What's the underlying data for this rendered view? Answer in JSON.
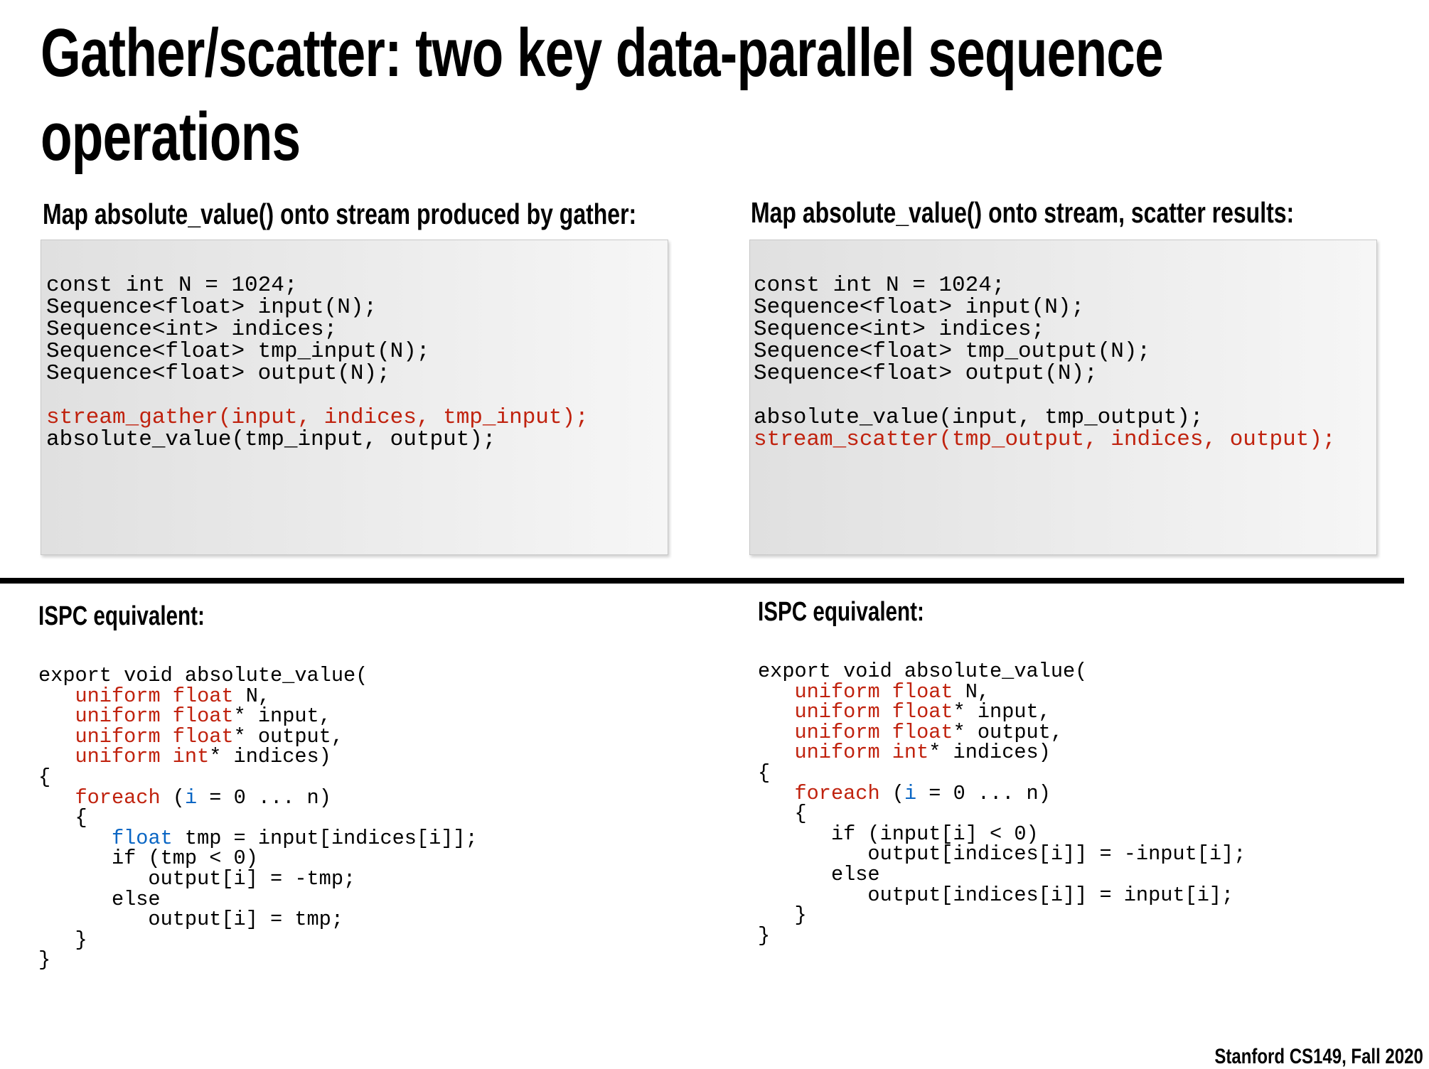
{
  "title": {
    "line1": "Gather/scatter: two key data-parallel sequence",
    "line2": "operations"
  },
  "left": {
    "heading": "Map absolute_value() onto stream produced by gather:",
    "code": [
      [
        {
          "t": "const int N = 1024;",
          "c": "k"
        }
      ],
      [
        {
          "t": "Sequence<float> input(N);",
          "c": "k"
        }
      ],
      [
        {
          "t": "Sequence<int> indices;",
          "c": "k"
        }
      ],
      [
        {
          "t": "Sequence<float> tmp_input(N);",
          "c": "k"
        }
      ],
      [
        {
          "t": "Sequence<float> output(N);",
          "c": "k"
        }
      ],
      [
        {
          "t": "",
          "c": "k"
        }
      ],
      [
        {
          "t": "stream_gather(input, indices, tmp_input);",
          "c": "r"
        }
      ],
      [
        {
          "t": "absolute_value(tmp_input, output);",
          "c": "k"
        }
      ]
    ],
    "ispc_heading": "ISPC equivalent:",
    "ispc": [
      [
        {
          "t": "export void absolute_value(",
          "c": "k"
        }
      ],
      [
        {
          "t": "   ",
          "c": "k"
        },
        {
          "t": "uniform float",
          "c": "r"
        },
        {
          "t": " N,",
          "c": "k"
        }
      ],
      [
        {
          "t": "   ",
          "c": "k"
        },
        {
          "t": "uniform float",
          "c": "r"
        },
        {
          "t": "* input,",
          "c": "k"
        }
      ],
      [
        {
          "t": "   ",
          "c": "k"
        },
        {
          "t": "uniform float",
          "c": "r"
        },
        {
          "t": "* output,",
          "c": "k"
        }
      ],
      [
        {
          "t": "   ",
          "c": "k"
        },
        {
          "t": "uniform int",
          "c": "r"
        },
        {
          "t": "* indices)",
          "c": "k"
        }
      ],
      [
        {
          "t": "{",
          "c": "k"
        }
      ],
      [
        {
          "t": "   ",
          "c": "k"
        },
        {
          "t": "foreach",
          "c": "r"
        },
        {
          "t": " (",
          "c": "k"
        },
        {
          "t": "i",
          "c": "b"
        },
        {
          "t": " = 0 ... n)",
          "c": "k"
        }
      ],
      [
        {
          "t": "   {",
          "c": "k"
        }
      ],
      [
        {
          "t": "      ",
          "c": "k"
        },
        {
          "t": "float",
          "c": "b"
        },
        {
          "t": " tmp = input[indices[i]];",
          "c": "k"
        }
      ],
      [
        {
          "t": "      if (tmp < 0)",
          "c": "k"
        }
      ],
      [
        {
          "t": "         output[i] = -tmp;",
          "c": "k"
        }
      ],
      [
        {
          "t": "      else",
          "c": "k"
        }
      ],
      [
        {
          "t": "         output[i] = tmp;",
          "c": "k"
        }
      ],
      [
        {
          "t": "   }",
          "c": "k"
        }
      ],
      [
        {
          "t": "}",
          "c": "k"
        }
      ]
    ]
  },
  "right": {
    "heading": "Map absolute_value() onto stream, scatter results:",
    "code": [
      [
        {
          "t": "const int N = 1024;",
          "c": "k"
        }
      ],
      [
        {
          "t": "Sequence<float> input(N);",
          "c": "k"
        }
      ],
      [
        {
          "t": "Sequence<int> indices;",
          "c": "k"
        }
      ],
      [
        {
          "t": "Sequence<float> tmp_output(N);",
          "c": "k"
        }
      ],
      [
        {
          "t": "Sequence<float> output(N);",
          "c": "k"
        }
      ],
      [
        {
          "t": "",
          "c": "k"
        }
      ],
      [
        {
          "t": "absolute_value(input, tmp_output);",
          "c": "k"
        }
      ],
      [
        {
          "t": "stream_scatter(tmp_output, indices, output);",
          "c": "r"
        }
      ]
    ],
    "ispc_heading": "ISPC equivalent:",
    "ispc": [
      [
        {
          "t": "export void absolute_value(",
          "c": "k"
        }
      ],
      [
        {
          "t": "   ",
          "c": "k"
        },
        {
          "t": "uniform float",
          "c": "r"
        },
        {
          "t": " N,",
          "c": "k"
        }
      ],
      [
        {
          "t": "   ",
          "c": "k"
        },
        {
          "t": "uniform float",
          "c": "r"
        },
        {
          "t": "* input,",
          "c": "k"
        }
      ],
      [
        {
          "t": "   ",
          "c": "k"
        },
        {
          "t": "uniform float",
          "c": "r"
        },
        {
          "t": "* output,",
          "c": "k"
        }
      ],
      [
        {
          "t": "   ",
          "c": "k"
        },
        {
          "t": "uniform int",
          "c": "r"
        },
        {
          "t": "* indices)",
          "c": "k"
        }
      ],
      [
        {
          "t": "{",
          "c": "k"
        }
      ],
      [
        {
          "t": "   ",
          "c": "k"
        },
        {
          "t": "foreach",
          "c": "r"
        },
        {
          "t": " (",
          "c": "k"
        },
        {
          "t": "i",
          "c": "b"
        },
        {
          "t": " = 0 ... n)",
          "c": "k"
        }
      ],
      [
        {
          "t": "   {",
          "c": "k"
        }
      ],
      [
        {
          "t": "      if (input[i] < 0)",
          "c": "k"
        }
      ],
      [
        {
          "t": "         output[indices[i]] = -input[i];",
          "c": "k"
        }
      ],
      [
        {
          "t": "      else",
          "c": "k"
        }
      ],
      [
        {
          "t": "         output[indices[i]] = input[i];",
          "c": "k"
        }
      ],
      [
        {
          "t": "   }",
          "c": "k"
        }
      ],
      [
        {
          "t": "}",
          "c": "k"
        }
      ]
    ]
  },
  "footer": "Stanford CS149, Fall 2020",
  "colors": {
    "keyword_red": "#c0220e",
    "keyword_blue": "#0a66c4"
  }
}
